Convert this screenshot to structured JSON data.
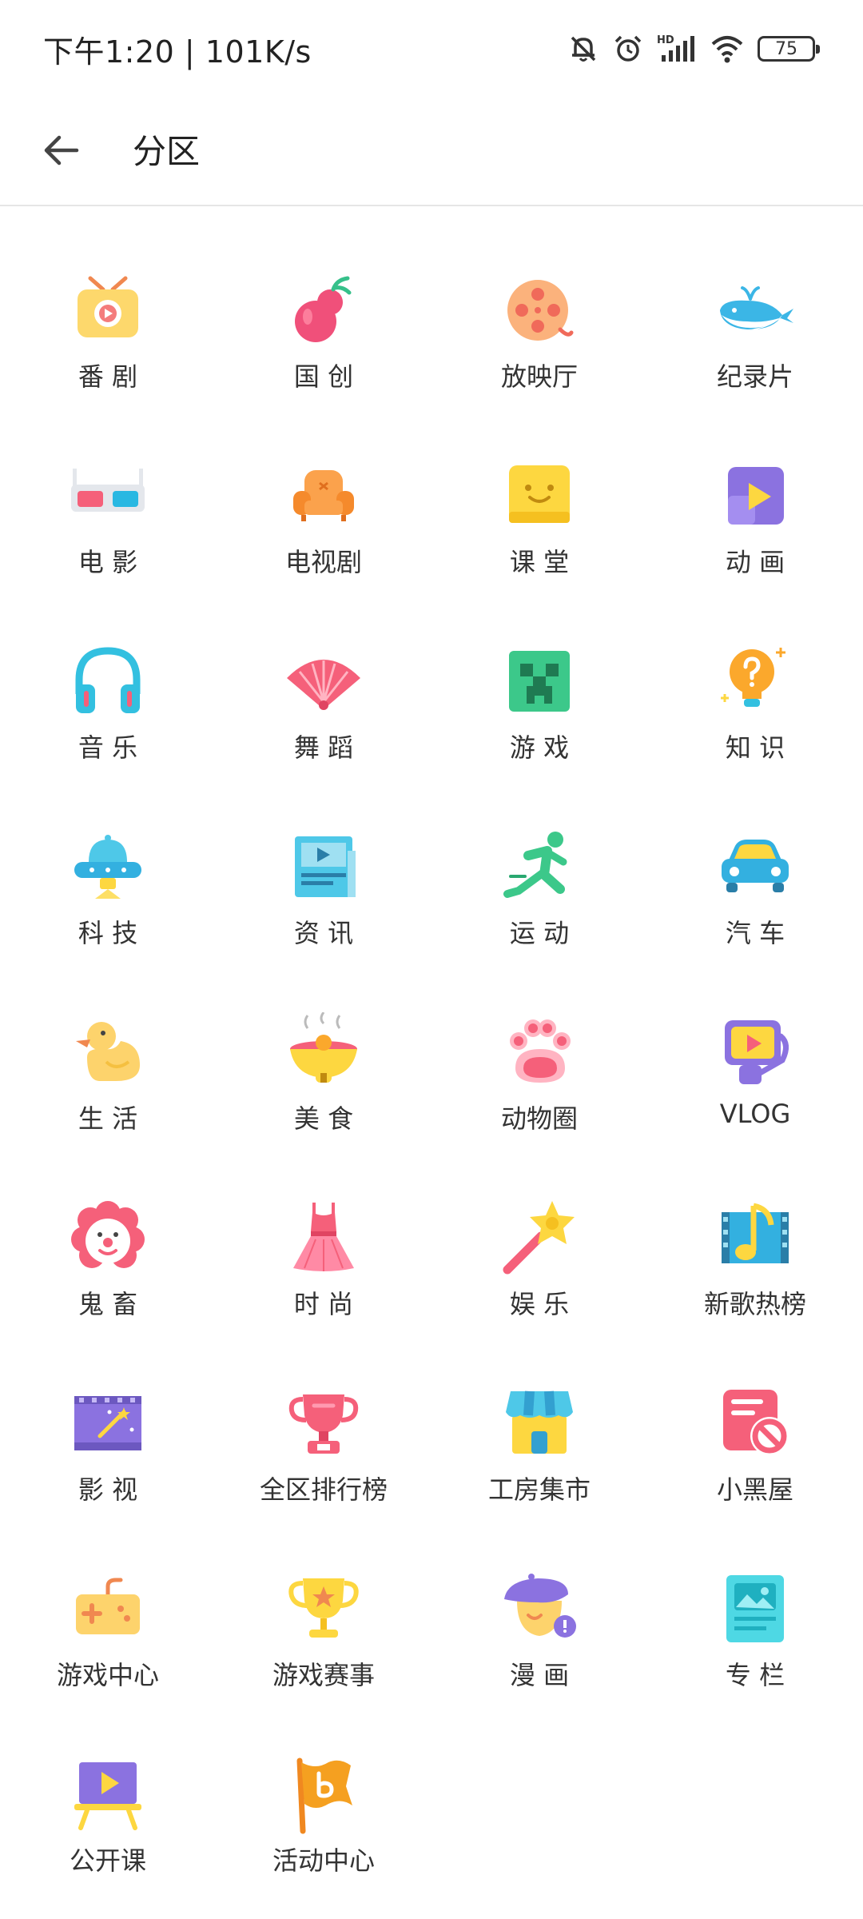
{
  "status_bar": {
    "time_speed": "下午1:20 | 101K/s",
    "battery": "75",
    "icons": [
      "mute-bell-icon",
      "alarm-icon",
      "hd-signal-icon",
      "wifi-icon",
      "battery-icon"
    ]
  },
  "header": {
    "back_icon": "arrow-left-icon",
    "title": "分区"
  },
  "zones": [
    {
      "label": "番 剧",
      "icon": "tv-icon"
    },
    {
      "label": "国 创",
      "icon": "gourd-icon"
    },
    {
      "label": "放映厅",
      "icon": "film-reel-icon"
    },
    {
      "label": "纪录片",
      "icon": "whale-icon"
    },
    {
      "label": "电 影",
      "icon": "3d-glasses-icon"
    },
    {
      "label": "电视剧",
      "icon": "armchair-icon"
    },
    {
      "label": "课 堂",
      "icon": "classroom-icon"
    },
    {
      "label": "动 画",
      "icon": "puzzle-play-icon"
    },
    {
      "label": "音 乐",
      "icon": "headphones-icon"
    },
    {
      "label": "舞 蹈",
      "icon": "fan-icon"
    },
    {
      "label": "游 戏",
      "icon": "creeper-icon"
    },
    {
      "label": "知 识",
      "icon": "lightbulb-question-icon"
    },
    {
      "label": "科 技",
      "icon": "ufo-icon"
    },
    {
      "label": "资 讯",
      "icon": "newspaper-icon"
    },
    {
      "label": "运 动",
      "icon": "runner-icon"
    },
    {
      "label": "汽 车",
      "icon": "car-icon"
    },
    {
      "label": "生 活",
      "icon": "duck-icon"
    },
    {
      "label": "美 食",
      "icon": "food-bowl-icon"
    },
    {
      "label": "动物圈",
      "icon": "paw-icon"
    },
    {
      "label": "VLOG",
      "icon": "vlog-camera-icon"
    },
    {
      "label": "鬼 畜",
      "icon": "clown-icon"
    },
    {
      "label": "时 尚",
      "icon": "dress-icon"
    },
    {
      "label": "娱 乐",
      "icon": "star-wand-icon"
    },
    {
      "label": "新歌热榜",
      "icon": "music-note-icon"
    },
    {
      "label": "影 视",
      "icon": "film-magic-icon"
    },
    {
      "label": "全区排行榜",
      "icon": "trophy-icon"
    },
    {
      "label": "工房集市",
      "icon": "shop-icon"
    },
    {
      "label": "小黑屋",
      "icon": "banned-icon"
    },
    {
      "label": "游戏中心",
      "icon": "gamepad-icon"
    },
    {
      "label": "游戏赛事",
      "icon": "cup-star-icon"
    },
    {
      "label": "漫 画",
      "icon": "comic-beret-icon"
    },
    {
      "label": "专 栏",
      "icon": "article-icon"
    },
    {
      "label": "公开课",
      "icon": "easel-icon"
    },
    {
      "label": "活动中心",
      "icon": "flag-icon"
    }
  ]
}
